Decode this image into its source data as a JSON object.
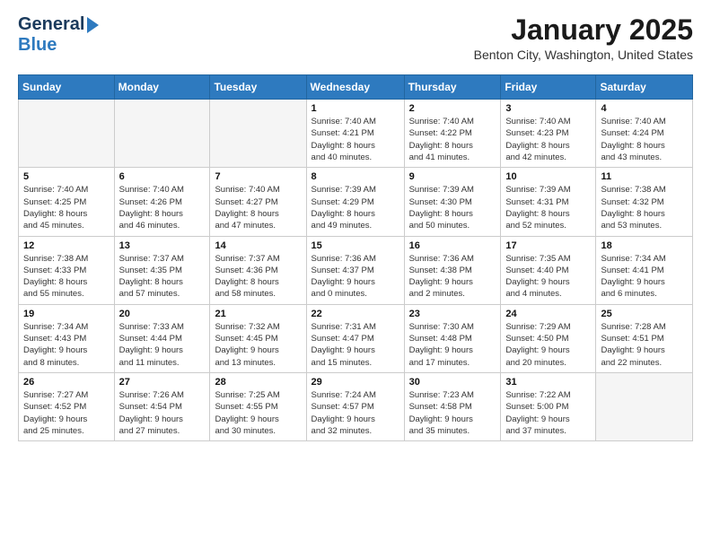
{
  "header": {
    "logo_line1": "General",
    "logo_line2": "Blue",
    "month": "January 2025",
    "location": "Benton City, Washington, United States"
  },
  "weekdays": [
    "Sunday",
    "Monday",
    "Tuesday",
    "Wednesday",
    "Thursday",
    "Friday",
    "Saturday"
  ],
  "weeks": [
    [
      {
        "day": "",
        "info": "",
        "shaded": true
      },
      {
        "day": "",
        "info": "",
        "shaded": true
      },
      {
        "day": "",
        "info": "",
        "shaded": true
      },
      {
        "day": "1",
        "info": "Sunrise: 7:40 AM\nSunset: 4:21 PM\nDaylight: 8 hours\nand 40 minutes.",
        "shaded": false
      },
      {
        "day": "2",
        "info": "Sunrise: 7:40 AM\nSunset: 4:22 PM\nDaylight: 8 hours\nand 41 minutes.",
        "shaded": false
      },
      {
        "day": "3",
        "info": "Sunrise: 7:40 AM\nSunset: 4:23 PM\nDaylight: 8 hours\nand 42 minutes.",
        "shaded": false
      },
      {
        "day": "4",
        "info": "Sunrise: 7:40 AM\nSunset: 4:24 PM\nDaylight: 8 hours\nand 43 minutes.",
        "shaded": false
      }
    ],
    [
      {
        "day": "5",
        "info": "Sunrise: 7:40 AM\nSunset: 4:25 PM\nDaylight: 8 hours\nand 45 minutes.",
        "shaded": false
      },
      {
        "day": "6",
        "info": "Sunrise: 7:40 AM\nSunset: 4:26 PM\nDaylight: 8 hours\nand 46 minutes.",
        "shaded": false
      },
      {
        "day": "7",
        "info": "Sunrise: 7:40 AM\nSunset: 4:27 PM\nDaylight: 8 hours\nand 47 minutes.",
        "shaded": false
      },
      {
        "day": "8",
        "info": "Sunrise: 7:39 AM\nSunset: 4:29 PM\nDaylight: 8 hours\nand 49 minutes.",
        "shaded": false
      },
      {
        "day": "9",
        "info": "Sunrise: 7:39 AM\nSunset: 4:30 PM\nDaylight: 8 hours\nand 50 minutes.",
        "shaded": false
      },
      {
        "day": "10",
        "info": "Sunrise: 7:39 AM\nSunset: 4:31 PM\nDaylight: 8 hours\nand 52 minutes.",
        "shaded": false
      },
      {
        "day": "11",
        "info": "Sunrise: 7:38 AM\nSunset: 4:32 PM\nDaylight: 8 hours\nand 53 minutes.",
        "shaded": false
      }
    ],
    [
      {
        "day": "12",
        "info": "Sunrise: 7:38 AM\nSunset: 4:33 PM\nDaylight: 8 hours\nand 55 minutes.",
        "shaded": false
      },
      {
        "day": "13",
        "info": "Sunrise: 7:37 AM\nSunset: 4:35 PM\nDaylight: 8 hours\nand 57 minutes.",
        "shaded": false
      },
      {
        "day": "14",
        "info": "Sunrise: 7:37 AM\nSunset: 4:36 PM\nDaylight: 8 hours\nand 58 minutes.",
        "shaded": false
      },
      {
        "day": "15",
        "info": "Sunrise: 7:36 AM\nSunset: 4:37 PM\nDaylight: 9 hours\nand 0 minutes.",
        "shaded": false
      },
      {
        "day": "16",
        "info": "Sunrise: 7:36 AM\nSunset: 4:38 PM\nDaylight: 9 hours\nand 2 minutes.",
        "shaded": false
      },
      {
        "day": "17",
        "info": "Sunrise: 7:35 AM\nSunset: 4:40 PM\nDaylight: 9 hours\nand 4 minutes.",
        "shaded": false
      },
      {
        "day": "18",
        "info": "Sunrise: 7:34 AM\nSunset: 4:41 PM\nDaylight: 9 hours\nand 6 minutes.",
        "shaded": false
      }
    ],
    [
      {
        "day": "19",
        "info": "Sunrise: 7:34 AM\nSunset: 4:43 PM\nDaylight: 9 hours\nand 8 minutes.",
        "shaded": false
      },
      {
        "day": "20",
        "info": "Sunrise: 7:33 AM\nSunset: 4:44 PM\nDaylight: 9 hours\nand 11 minutes.",
        "shaded": false
      },
      {
        "day": "21",
        "info": "Sunrise: 7:32 AM\nSunset: 4:45 PM\nDaylight: 9 hours\nand 13 minutes.",
        "shaded": false
      },
      {
        "day": "22",
        "info": "Sunrise: 7:31 AM\nSunset: 4:47 PM\nDaylight: 9 hours\nand 15 minutes.",
        "shaded": false
      },
      {
        "day": "23",
        "info": "Sunrise: 7:30 AM\nSunset: 4:48 PM\nDaylight: 9 hours\nand 17 minutes.",
        "shaded": false
      },
      {
        "day": "24",
        "info": "Sunrise: 7:29 AM\nSunset: 4:50 PM\nDaylight: 9 hours\nand 20 minutes.",
        "shaded": false
      },
      {
        "day": "25",
        "info": "Sunrise: 7:28 AM\nSunset: 4:51 PM\nDaylight: 9 hours\nand 22 minutes.",
        "shaded": false
      }
    ],
    [
      {
        "day": "26",
        "info": "Sunrise: 7:27 AM\nSunset: 4:52 PM\nDaylight: 9 hours\nand 25 minutes.",
        "shaded": false
      },
      {
        "day": "27",
        "info": "Sunrise: 7:26 AM\nSunset: 4:54 PM\nDaylight: 9 hours\nand 27 minutes.",
        "shaded": false
      },
      {
        "day": "28",
        "info": "Sunrise: 7:25 AM\nSunset: 4:55 PM\nDaylight: 9 hours\nand 30 minutes.",
        "shaded": false
      },
      {
        "day": "29",
        "info": "Sunrise: 7:24 AM\nSunset: 4:57 PM\nDaylight: 9 hours\nand 32 minutes.",
        "shaded": false
      },
      {
        "day": "30",
        "info": "Sunrise: 7:23 AM\nSunset: 4:58 PM\nDaylight: 9 hours\nand 35 minutes.",
        "shaded": false
      },
      {
        "day": "31",
        "info": "Sunrise: 7:22 AM\nSunset: 5:00 PM\nDaylight: 9 hours\nand 37 minutes.",
        "shaded": false
      },
      {
        "day": "",
        "info": "",
        "shaded": true
      }
    ]
  ]
}
